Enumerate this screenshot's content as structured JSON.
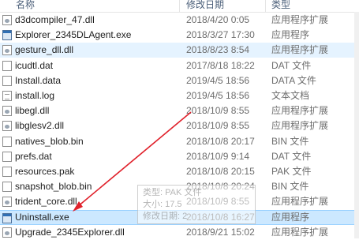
{
  "columns": {
    "name": "名称",
    "date": "修改日期",
    "type": "类型"
  },
  "files": [
    {
      "name": "d3dcompiler_47.dll",
      "date": "2018/4/20 0:05",
      "type": "应用程序扩展",
      "icon": "gear"
    },
    {
      "name": "Explorer_2345DLAgent.exe",
      "date": "2018/3/27 17:30",
      "type": "应用程序",
      "icon": "exe"
    },
    {
      "name": "gesture_dll.dll",
      "date": "2018/8/23 8:54",
      "type": "应用程序扩展",
      "icon": "gear",
      "state": "hover"
    },
    {
      "name": "icudtl.dat",
      "date": "2017/8/18 18:22",
      "type": "DAT 文件",
      "icon": "file"
    },
    {
      "name": "Install.data",
      "date": "2019/4/5 18:56",
      "type": "DATA 文件",
      "icon": "file"
    },
    {
      "name": "install.log",
      "date": "2019/4/5 18:56",
      "type": "文本文档",
      "icon": "txt"
    },
    {
      "name": "libegl.dll",
      "date": "2018/10/9 8:55",
      "type": "应用程序扩展",
      "icon": "gear"
    },
    {
      "name": "libglesv2.dll",
      "date": "2018/10/9 8:55",
      "type": "应用程序扩展",
      "icon": "gear"
    },
    {
      "name": "natives_blob.bin",
      "date": "2018/10/8 20:17",
      "type": "BIN 文件",
      "icon": "file"
    },
    {
      "name": "prefs.dat",
      "date": "2018/10/9 9:14",
      "type": "DAT 文件",
      "icon": "file"
    },
    {
      "name": "resources.pak",
      "date": "2018/10/8 20:15",
      "type": "PAK 文件",
      "icon": "file"
    },
    {
      "name": "snapshot_blob.bin",
      "date": "2018/10/8 20:24",
      "type": "BIN 文件",
      "icon": "file"
    },
    {
      "name": "trident_core.dll",
      "date": "2018/10/9 8:55",
      "type": "应用程序扩展",
      "icon": "gear"
    },
    {
      "name": "Uninstall.exe",
      "date": "2018/10/8 16:27",
      "type": "应用程序",
      "icon": "exe",
      "state": "selected"
    },
    {
      "name": "Upgrade_2345Explorer.dll",
      "date": "2018/9/21 15:02",
      "type": "应用程序扩展",
      "icon": "gear"
    }
  ],
  "tooltip": {
    "line1": "类型: PAK 文件",
    "line2": "大小: 17.5",
    "line3": "修改日期: 2"
  },
  "colors": {
    "arrow": "#e0212b",
    "selected": "#cce8ff",
    "hover": "#e5f3ff"
  }
}
